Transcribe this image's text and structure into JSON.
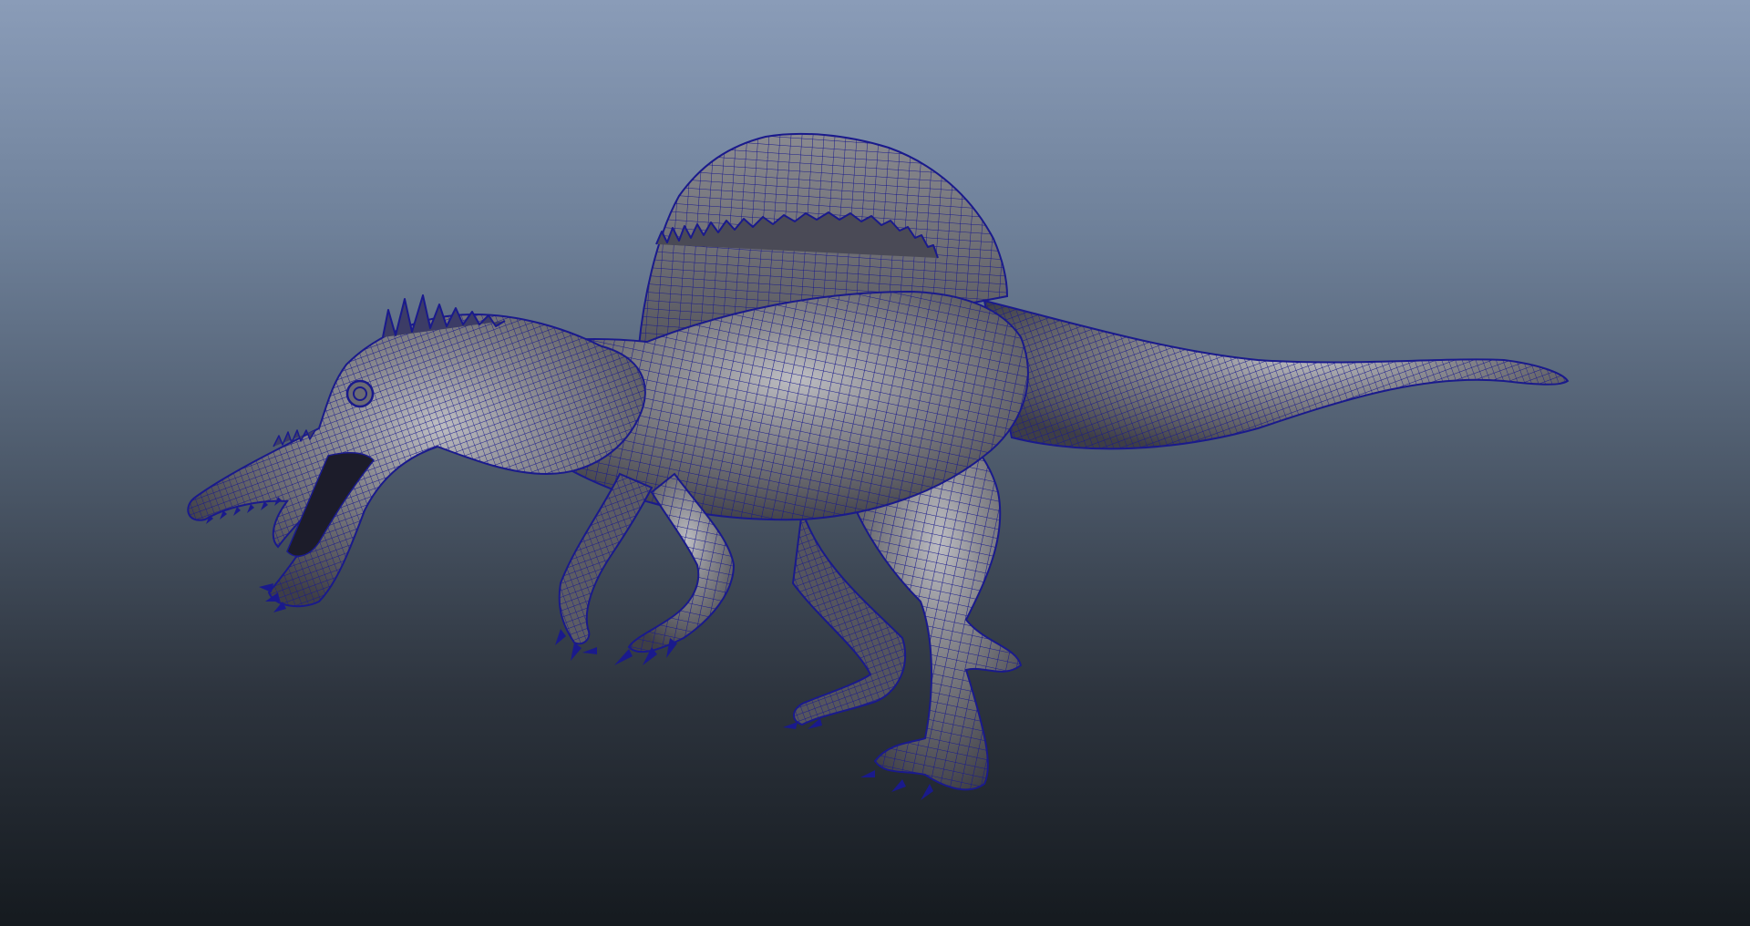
{
  "viewport": {
    "mode": "wireframe-on-shaded",
    "background_top": "#8a9cb8",
    "background_bottom": "#151a1f"
  },
  "model": {
    "subject": "spinosaurus-icon",
    "wire_color": "#1a1a8c",
    "surface_color": "#6c6c70",
    "highlight_color": "#bdbdc2"
  }
}
